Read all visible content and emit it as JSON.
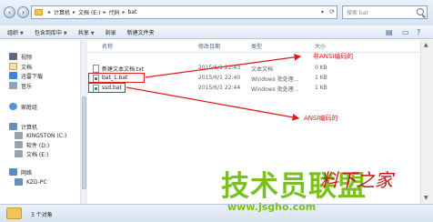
{
  "window": {
    "breadcrumbs": [
      "计算机",
      "文档 (E:)",
      "代码",
      "bat"
    ],
    "search_placeholder": "搜索 bat"
  },
  "toolbar": {
    "organize": "组织",
    "include_in_library": "包含到库中",
    "share": "共享",
    "burn": "刻录",
    "new_folder": "新建文件夹"
  },
  "nav": {
    "video": "视频",
    "documents": "文档",
    "thunder": "迅雷下载",
    "music": "音乐",
    "homegroup": "家庭组",
    "computer": "计算机",
    "drive_c": "KINGSTON (C:)",
    "drive_d": "软件 (D:)",
    "drive_e": "文档 (E:)",
    "network": "网络",
    "pc": "KZG-PC"
  },
  "columns": {
    "name": "名称",
    "date": "修改日期",
    "type": "类型",
    "size": "大小"
  },
  "files": [
    {
      "name": "新建文本文档.txt",
      "date": "2015/6/1 22:43",
      "type": "文本文档",
      "size": "0 KB"
    },
    {
      "name": "bat_1.bat",
      "date": "2015/6/1 22:40",
      "type": "Windows 批处理...",
      "size": "1 KB"
    },
    {
      "name": "ssd.bat",
      "date": "2015/6/1 22:44",
      "type": "Windows 批处理...",
      "size": "1 KB"
    }
  ],
  "annotations": {
    "top": "非ANSI编码的",
    "bottom": "ANSI编码的"
  },
  "status": {
    "item_count": "3 个对象"
  },
  "watermark": {
    "title": "技术员联盟",
    "url": "www.jsgho.com",
    "signature": "料下之家"
  },
  "colors": {
    "annotation_red": "#e21c1c",
    "watermark_green": "#7ac11e"
  }
}
